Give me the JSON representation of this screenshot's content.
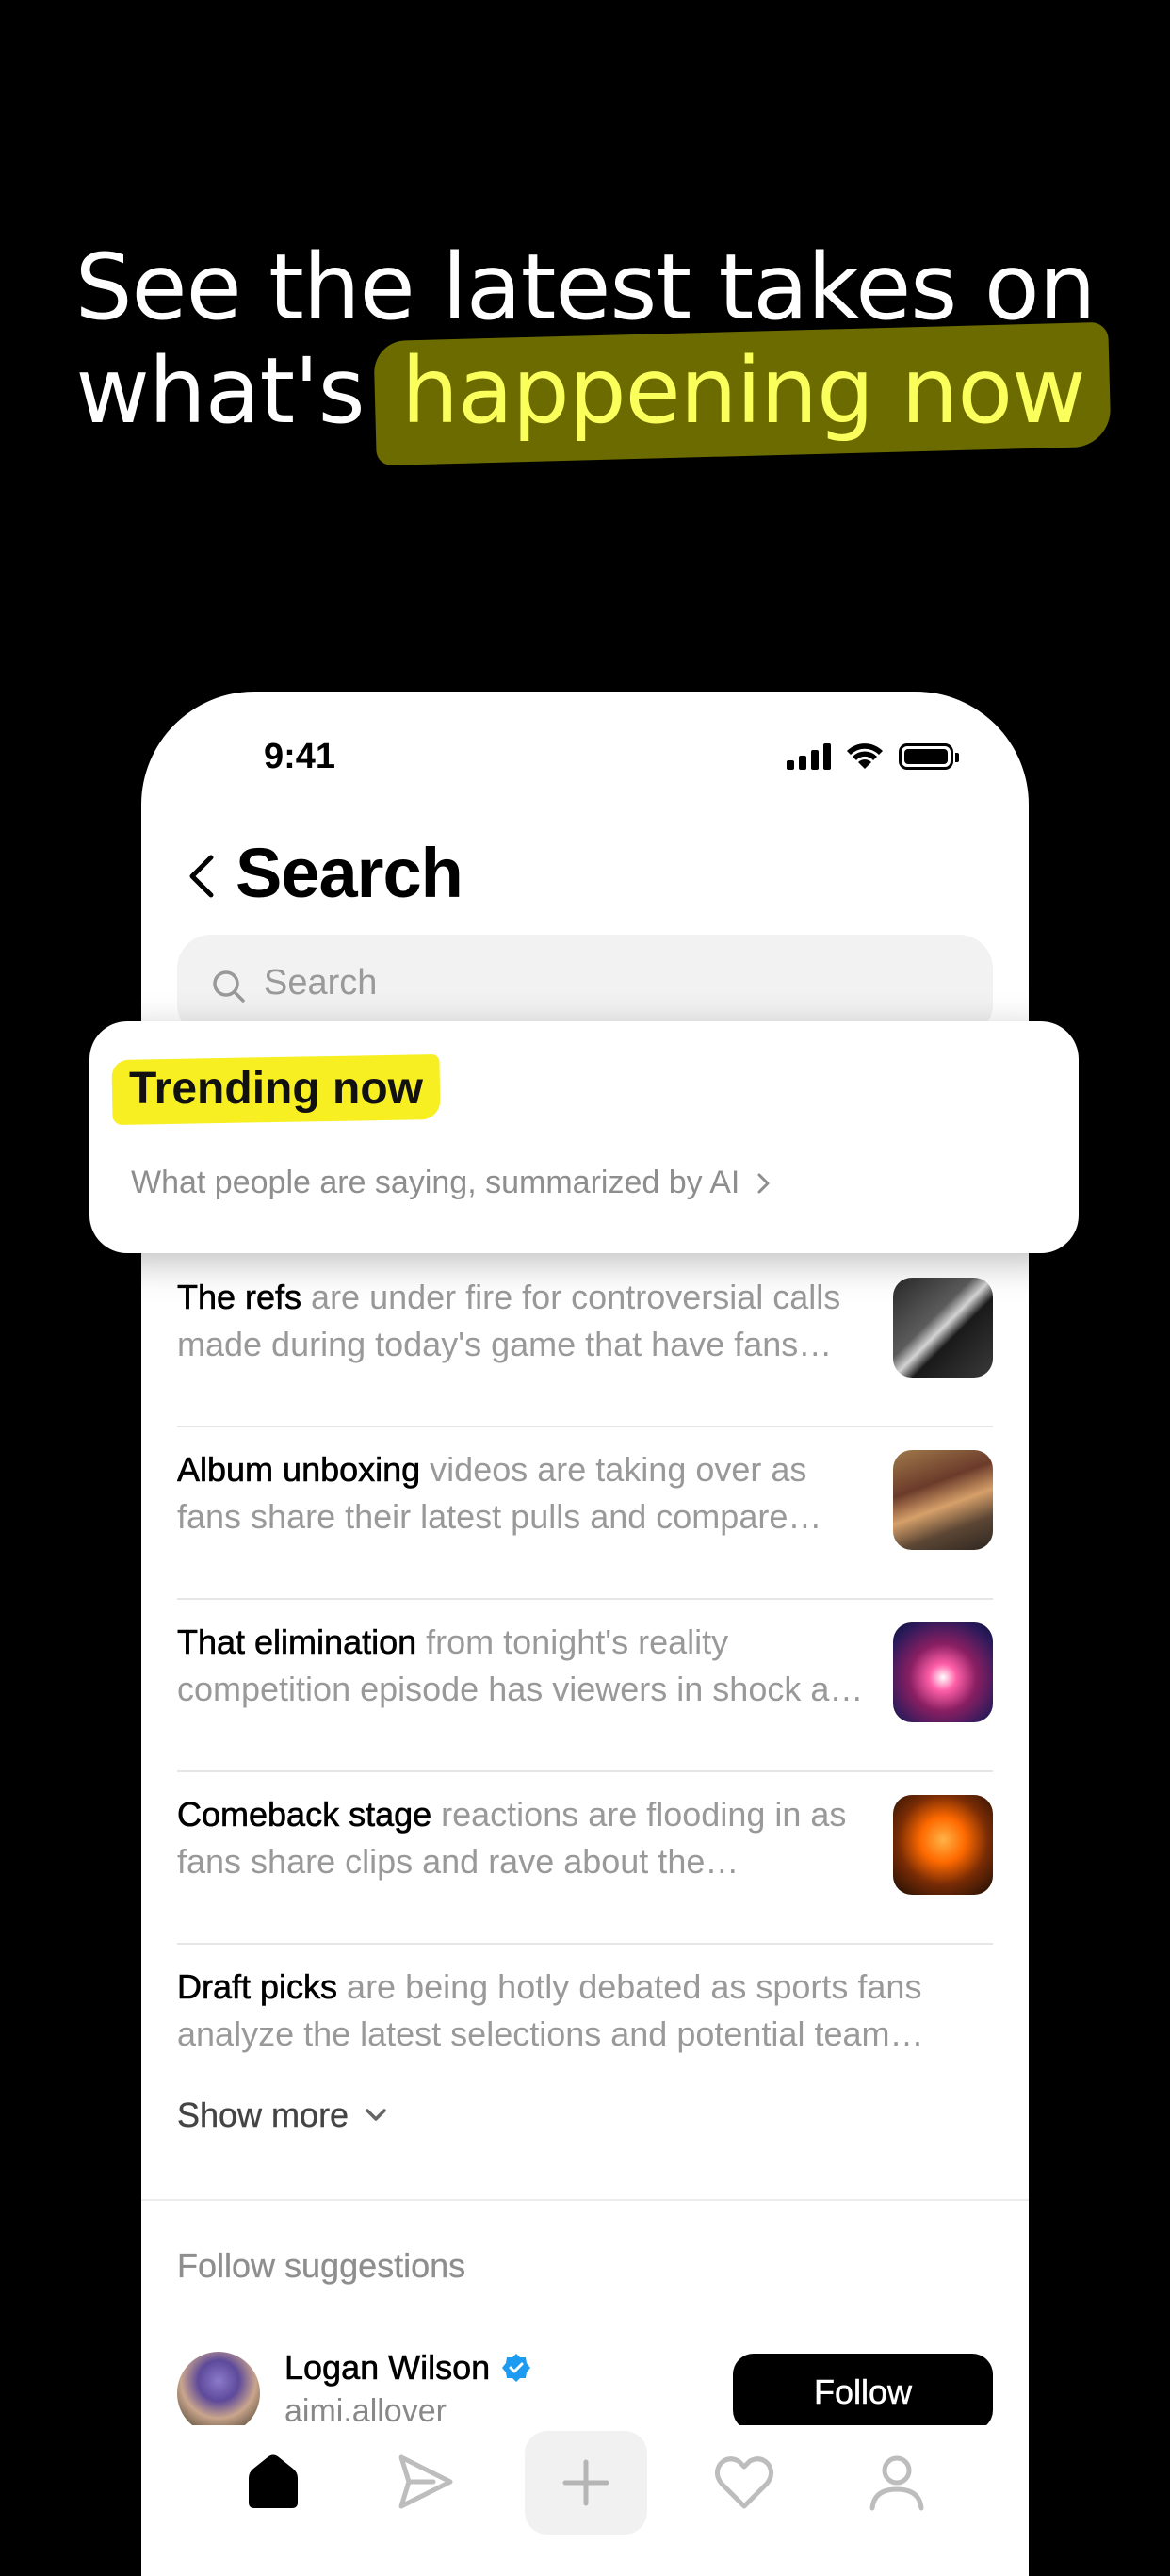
{
  "headline": {
    "line1": "See the latest takes on",
    "line2_prefix": "what's",
    "line2_highlight": "happening now"
  },
  "status_bar": {
    "time": "9:41"
  },
  "header": {
    "title": "Search"
  },
  "search": {
    "placeholder": "Search"
  },
  "trending_card": {
    "title": "Trending now",
    "subtitle": "What people are saying, summarized by AI"
  },
  "trends": [
    {
      "topic": "The refs",
      "summary": " are under fire for controversial calls made during today's game that have fans react to decisions",
      "has_thumb": true
    },
    {
      "topic": "Album unboxing",
      "summary": " videos are taking over as fans share their latest pulls and compare photocards",
      "has_thumb": true
    },
    {
      "topic": "That elimination",
      "summary": " from tonight's reality competition episode has viewers in shock and debating",
      "has_thumb": true
    },
    {
      "topic": "Comeback stage",
      "summary": " reactions are flooding in as fans share clips and rave about the choreography",
      "has_thumb": true
    },
    {
      "topic": "Draft picks",
      "summary": " are being hotly debated as sports fans analyze the latest selections and potential team lineups",
      "has_thumb": false
    }
  ],
  "show_more": {
    "label": "Show more"
  },
  "follow_suggestions": {
    "heading": "Follow suggestions",
    "user": {
      "name": "Logan Wilson",
      "handle": "aimi.allover",
      "verified": true
    },
    "button": "Follow"
  },
  "colors": {
    "highlight_yellow": "#f7ef22",
    "headline_highlight_text": "#fbff5c",
    "verified_blue": "#1d9bf0"
  },
  "tabbar": {
    "icons": [
      "home-icon",
      "send-icon",
      "plus-icon",
      "heart-icon",
      "profile-icon"
    ]
  }
}
